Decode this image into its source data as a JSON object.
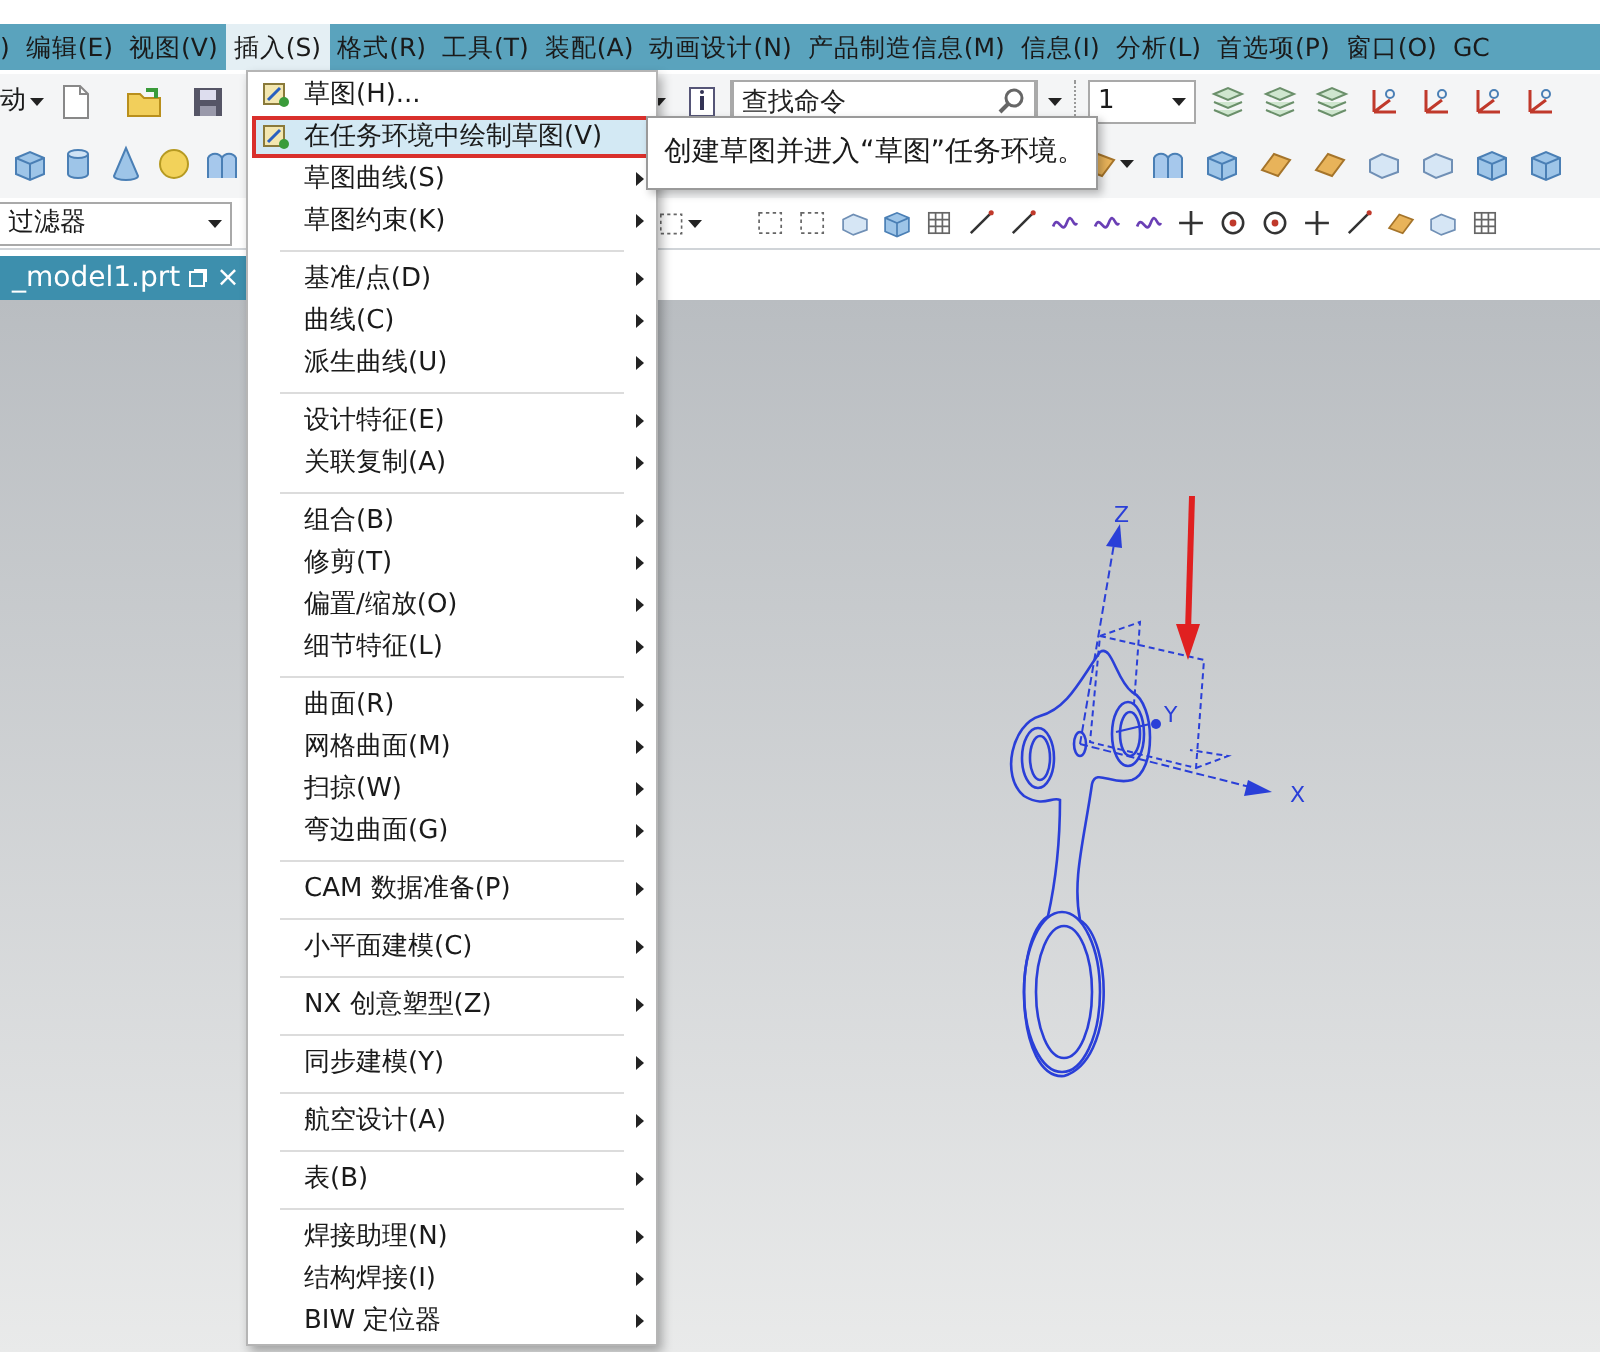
{
  "menubar": [
    {
      "label": ")",
      "selected": false
    },
    {
      "label": "编辑(E)",
      "selected": false
    },
    {
      "label": "视图(V)",
      "selected": false
    },
    {
      "label": "插入(S)",
      "selected": true
    },
    {
      "label": "格式(R)",
      "selected": false
    },
    {
      "label": "工具(T)",
      "selected": false
    },
    {
      "label": "装配(A)",
      "selected": false
    },
    {
      "label": "动画设计(N)",
      "selected": false
    },
    {
      "label": "产品制造信息(M)",
      "selected": false
    },
    {
      "label": "信息(I)",
      "selected": false
    },
    {
      "label": "分析(L)",
      "selected": false
    },
    {
      "label": "首选项(P)",
      "selected": false
    },
    {
      "label": "窗口(O)",
      "selected": false
    },
    {
      "label": "GC",
      "selected": false
    }
  ],
  "toolbar": {
    "command_prefix": "动",
    "search": {
      "value": "查找命令"
    },
    "layer_select": {
      "value": "1"
    }
  },
  "selection_bar": {
    "filter": {
      "value": "过滤器"
    }
  },
  "document_tab": {
    "label": "_model1.prt",
    "selected": true,
    "close": "×"
  },
  "insert_menu": {
    "groups": [
      {
        "items": [
          {
            "label": "草图(H)...",
            "kind": "command",
            "selected": false
          },
          {
            "label": "在任务环境中绘制草图(V)",
            "kind": "command",
            "selected": true
          },
          {
            "label": "草图曲线(S)",
            "kind": "submenu",
            "selected": false
          },
          {
            "label": "草图约束(K)",
            "kind": "submenu",
            "selected": false
          }
        ]
      },
      {
        "items": [
          {
            "label": "基准/点(D)",
            "kind": "submenu",
            "selected": false
          },
          {
            "label": "曲线(C)",
            "kind": "submenu",
            "selected": false
          },
          {
            "label": "派生曲线(U)",
            "kind": "submenu",
            "selected": false
          }
        ]
      },
      {
        "items": [
          {
            "label": "设计特征(E)",
            "kind": "submenu",
            "selected": false
          },
          {
            "label": "关联复制(A)",
            "kind": "submenu",
            "selected": false
          }
        ]
      },
      {
        "items": [
          {
            "label": "组合(B)",
            "kind": "submenu",
            "selected": false
          },
          {
            "label": "修剪(T)",
            "kind": "submenu",
            "selected": false
          },
          {
            "label": "偏置/缩放(O)",
            "kind": "submenu",
            "selected": false
          },
          {
            "label": "细节特征(L)",
            "kind": "submenu",
            "selected": false
          }
        ]
      },
      {
        "items": [
          {
            "label": "曲面(R)",
            "kind": "submenu",
            "selected": false
          },
          {
            "label": "网格曲面(M)",
            "kind": "submenu",
            "selected": false
          },
          {
            "label": "扫掠(W)",
            "kind": "submenu",
            "selected": false
          },
          {
            "label": "弯边曲面(G)",
            "kind": "submenu",
            "selected": false
          }
        ]
      },
      {
        "items": [
          {
            "label": "CAM 数据准备(P)",
            "kind": "submenu",
            "selected": false
          }
        ]
      },
      {
        "items": [
          {
            "label": "小平面建模(C)",
            "kind": "submenu",
            "selected": false
          }
        ]
      },
      {
        "items": [
          {
            "label": "NX 创意塑型(Z)",
            "kind": "submenu",
            "selected": false
          }
        ]
      },
      {
        "items": [
          {
            "label": "同步建模(Y)",
            "kind": "submenu",
            "selected": false
          }
        ]
      },
      {
        "items": [
          {
            "label": "航空设计(A)",
            "kind": "submenu",
            "selected": false
          }
        ]
      },
      {
        "items": [
          {
            "label": "表(B)",
            "kind": "submenu",
            "selected": false
          }
        ]
      },
      {
        "items": [
          {
            "label": "焊接助理(N)",
            "kind": "submenu",
            "selected": false
          },
          {
            "label": "结构焊接(I)",
            "kind": "submenu",
            "selected": false
          },
          {
            "label": "BIW 定位器",
            "kind": "submenu",
            "selected": false
          }
        ]
      }
    ]
  },
  "tooltip": {
    "text": "创建草图并进入“草图”任务环境。"
  },
  "graphics": {
    "axis_labels": {
      "z": "Z",
      "x": "X",
      "y": "Y"
    }
  }
}
